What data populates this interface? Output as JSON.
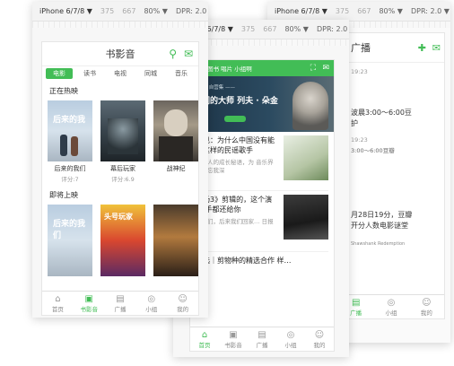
{
  "device_bar": {
    "device": "iPhone 6/7/8 ▼",
    "width": "375",
    "times": "×",
    "height": "667",
    "zoom": "80% ▼",
    "dpr": "DPR: 2.0 ▼"
  },
  "colors": {
    "accent": "#42bd56"
  },
  "left_phone": {
    "title": "书影音",
    "tabs": [
      "电影",
      "读书",
      "电视",
      "同城",
      "音乐"
    ],
    "now_showing_label": "正在热映",
    "coming_soon_label": "即将上映",
    "now_showing": [
      {
        "title": "后来的我们",
        "score": "评分:7"
      },
      {
        "title": "幕后玩家",
        "score": "评分:6.9"
      },
      {
        "title": "战神纪",
        "score": ""
      }
    ],
    "coming_soon_poster_texts": [
      "后来的我们",
      "头号玩家",
      ""
    ],
    "coming_soon_partial_title": "后来的我们",
    "tabbar": [
      {
        "label": "首页",
        "icon": "home-icon",
        "glyph": "⌂"
      },
      {
        "label": "书影音",
        "icon": "film-icon",
        "glyph": "▣"
      },
      {
        "label": "广播",
        "icon": "broadcast-icon",
        "glyph": "▤"
      },
      {
        "label": "小组",
        "icon": "group-icon",
        "glyph": "◎"
      },
      {
        "label": "我的",
        "icon": "profile-icon",
        "glyph": "☺"
      }
    ]
  },
  "middle_phone": {
    "header": "影视 图书 唱片 小组啊",
    "banner": {
      "title_line": "我们的大师 列夫 · 朵金",
      "caption_left": "—— 自营集 ——",
      "caption_right": "…"
    },
    "feed": [
      {
        "headline": "意见：为什么中国没有能 伦这样的民谣歌手",
        "sub": "一代人的成长秘语，为 音乐界发展忘我深"
      },
      {
        "headline": "剧场3》剪辑的，这个演算 手都还给你",
        "sub": "孩子们，后来我们回家… 日报"
      },
      {
        "headline": "精选｜剪物种的精选合作 样…",
        "sub": ""
      }
    ],
    "tabbar": [
      {
        "label": "首页",
        "glyph": "⌂"
      },
      {
        "label": "书影音",
        "glyph": "▣"
      },
      {
        "label": "广播",
        "glyph": "▤"
      },
      {
        "label": "小组",
        "glyph": "◎"
      },
      {
        "label": "我的",
        "glyph": "☺"
      }
    ]
  },
  "right_phone": {
    "title": "广播",
    "entries": [
      {
        "line1": "19:23",
        "line2": ""
      },
      {
        "line1": "波晨3:00～6:00豆",
        "line2": "护"
      },
      {
        "line1": "19:23",
        "line2": "3:00～6:00豆瓣"
      },
      {
        "line1": "月28日19分，豆瓣",
        "line2": "开分人数电影谜堂"
      }
    ],
    "small_caption": "Shawshank Redemption",
    "tabbar": [
      {
        "label": "广播",
        "glyph": "▤"
      },
      {
        "label": "小组",
        "glyph": "◎"
      },
      {
        "label": "我的",
        "glyph": "☺"
      }
    ]
  }
}
